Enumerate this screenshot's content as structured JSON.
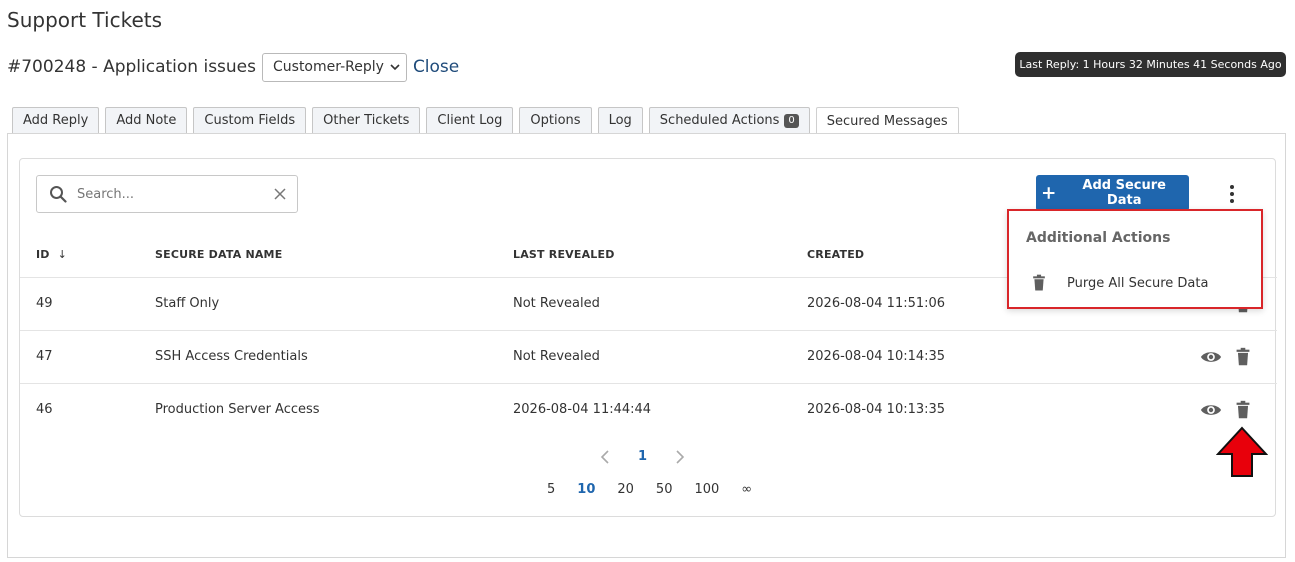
{
  "page": {
    "title": "Support Tickets"
  },
  "ticket": {
    "title": "#700248 - Application issues",
    "status_selected": "Customer-Reply",
    "close_label": "Close",
    "last_reply": "Last Reply: 1 Hours 32 Minutes 41 Seconds Ago"
  },
  "tabs": [
    {
      "label": "Add Reply"
    },
    {
      "label": "Add Note"
    },
    {
      "label": "Custom Fields"
    },
    {
      "label": "Other Tickets"
    },
    {
      "label": "Client Log"
    },
    {
      "label": "Options"
    },
    {
      "label": "Log"
    },
    {
      "label": "Scheduled Actions",
      "badge": "0"
    },
    {
      "label": "Secured Messages",
      "active": true
    }
  ],
  "toolbar": {
    "search_placeholder": "Search...",
    "add_label": "Add Secure Data"
  },
  "table": {
    "columns": [
      "ID",
      "SECURE DATA NAME",
      "LAST REVEALED",
      "CREATED"
    ],
    "sort_indicator": "↓",
    "rows": [
      {
        "id": "49",
        "name": "Staff Only",
        "last_revealed": "Not Revealed",
        "created": "2026-08-04 11:51:06"
      },
      {
        "id": "47",
        "name": "SSH Access Credentials",
        "last_revealed": "Not Revealed",
        "created": "2026-08-04 10:14:35"
      },
      {
        "id": "46",
        "name": "Production Server Access",
        "last_revealed": "2026-08-04 11:44:44",
        "created": "2026-08-04 10:13:35"
      }
    ]
  },
  "pagination": {
    "current_page": "1",
    "page_sizes": [
      "5",
      "10",
      "20",
      "50",
      "100",
      "∞"
    ],
    "selected_size": "10"
  },
  "dropdown": {
    "header": "Additional Actions",
    "item": "Purge All Secure Data"
  },
  "icons": {
    "search": "search-icon",
    "clear": "close-icon",
    "add": "plus-icon",
    "more": "kebab-menu-icon",
    "reveal": "eye-icon",
    "delete": "trash-icon",
    "annotation": "red-arrow-up"
  },
  "colors": {
    "primary": "#1f66ae",
    "highlight": "#d9262a",
    "icon_gray": "#5f5f5f"
  }
}
